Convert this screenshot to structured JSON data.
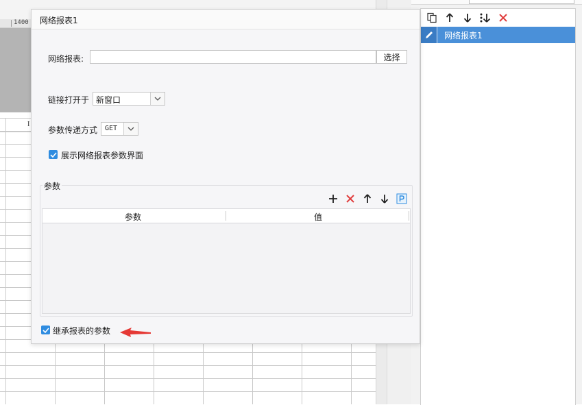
{
  "background": {
    "ruler_label": "1400",
    "column_letter": "I"
  },
  "right_panel": {
    "toolbar": {
      "copy_icon": "copy-icon",
      "up_icon": "arrow-up-icon",
      "down_icon": "arrow-down-icon",
      "sort_icon": "sort-down-icon",
      "delete_icon": "delete-x-icon"
    },
    "items": [
      {
        "label": "网络报表1",
        "icon": "pencil-icon",
        "selected": true
      }
    ]
  },
  "dialog": {
    "title": "网络报表1",
    "report_label": "网络报表:",
    "report_value": "",
    "select_button": "选择",
    "open_label": "链接打开于",
    "open_value": "新窗口",
    "method_label": "参数传递方式",
    "method_value": "GET",
    "show_params_label": "展示网络报表参数界面",
    "show_params_checked": true,
    "params": {
      "title": "参数",
      "columns": [
        "参数",
        "值"
      ],
      "rows": []
    },
    "inherit_label": "继承报表的参数",
    "inherit_checked": true
  },
  "colors": {
    "accent": "#2f8ce0",
    "selected_item": "#4a90d9",
    "delete": "#e03b3b",
    "annotation_arrow": "#e53935"
  }
}
